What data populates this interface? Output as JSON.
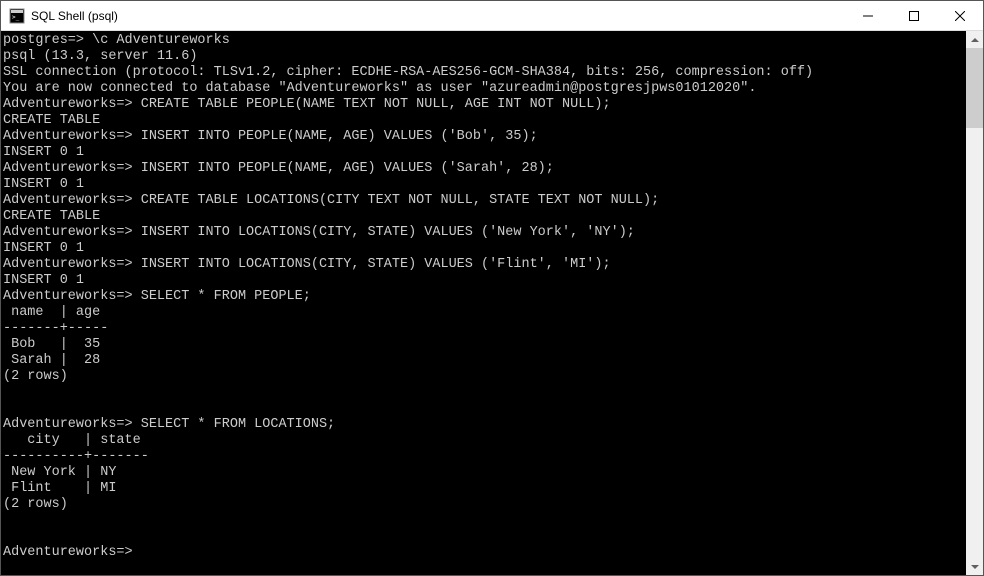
{
  "window": {
    "title": "SQL Shell (psql)"
  },
  "terminal": {
    "lines": [
      "postgres=> \\c Adventureworks",
      "psql (13.3, server 11.6)",
      "SSL connection (protocol: TLSv1.2, cipher: ECDHE-RSA-AES256-GCM-SHA384, bits: 256, compression: off)",
      "You are now connected to database \"Adventureworks\" as user \"azureadmin@postgresjpws01012020\".",
      "Adventureworks=> CREATE TABLE PEOPLE(NAME TEXT NOT NULL, AGE INT NOT NULL);",
      "CREATE TABLE",
      "Adventureworks=> INSERT INTO PEOPLE(NAME, AGE) VALUES ('Bob', 35);",
      "INSERT 0 1",
      "Adventureworks=> INSERT INTO PEOPLE(NAME, AGE) VALUES ('Sarah', 28);",
      "INSERT 0 1",
      "Adventureworks=> CREATE TABLE LOCATIONS(CITY TEXT NOT NULL, STATE TEXT NOT NULL);",
      "CREATE TABLE",
      "Adventureworks=> INSERT INTO LOCATIONS(CITY, STATE) VALUES ('New York', 'NY');",
      "INSERT 0 1",
      "Adventureworks=> INSERT INTO LOCATIONS(CITY, STATE) VALUES ('Flint', 'MI');",
      "INSERT 0 1",
      "Adventureworks=> SELECT * FROM PEOPLE;",
      " name  | age",
      "-------+-----",
      " Bob   |  35",
      " Sarah |  28",
      "(2 rows)",
      "",
      "",
      "Adventureworks=> SELECT * FROM LOCATIONS;",
      "   city   | state",
      "----------+-------",
      " New York | NY",
      " Flint    | MI",
      "(2 rows)",
      "",
      "",
      "Adventureworks=>"
    ],
    "prompt_last": "Adventureworks=>"
  }
}
